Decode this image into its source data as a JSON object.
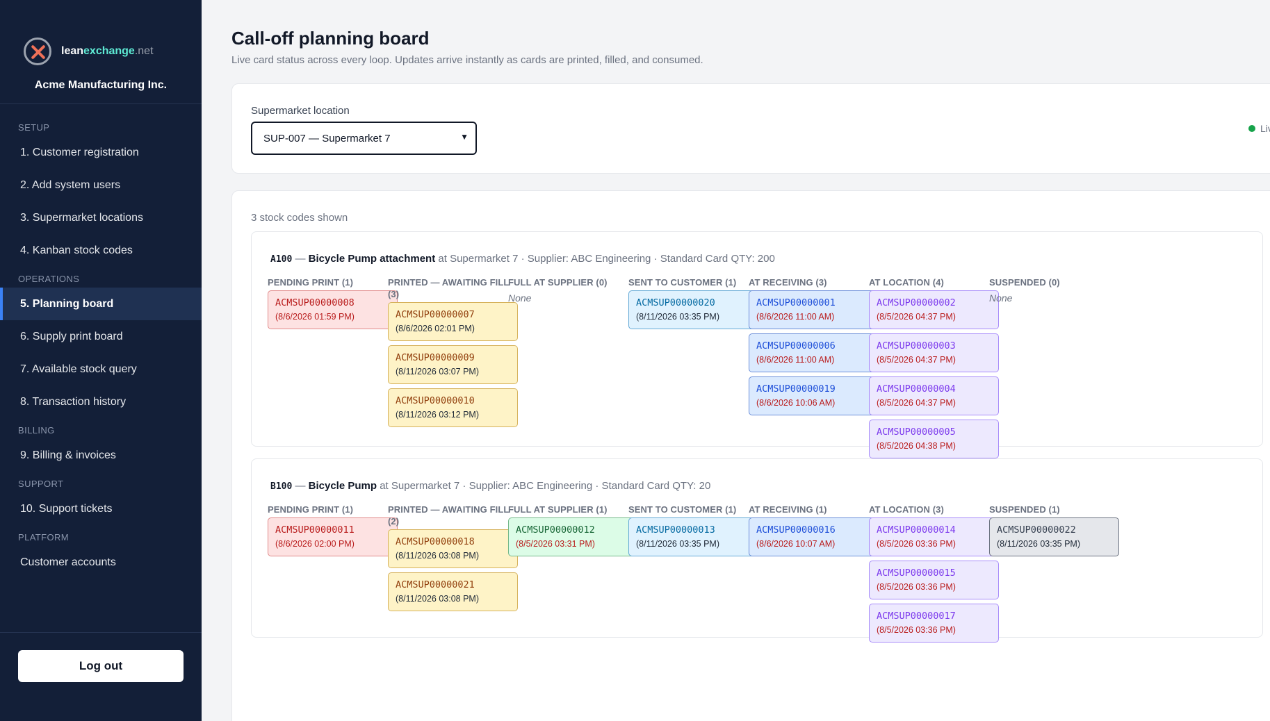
{
  "brand": {
    "logo_lean": "lean",
    "logo_ex": "exchange",
    "logo_net": ".net",
    "company": "Acme Manufacturing Inc."
  },
  "nav": {
    "sections": [
      {
        "label": "SETUP",
        "items": [
          "1. Customer registration",
          "2. Add system users",
          "3. Supermarket locations",
          "4. Kanban stock codes"
        ]
      },
      {
        "label": "OPERATIONS",
        "items": [
          "5. Planning board",
          "6. Supply print board",
          "7. Available stock query",
          "8. Transaction history"
        ]
      },
      {
        "label": "BILLING",
        "items": [
          "9. Billing & invoices"
        ]
      },
      {
        "label": "SUPPORT",
        "items": [
          "10. Support tickets"
        ]
      },
      {
        "label": "PLATFORM",
        "items": [
          "Customer accounts"
        ]
      }
    ],
    "active": "5. Planning board",
    "logout": "Log out"
  },
  "page": {
    "title": "Call-off planning board",
    "subtitle": "Live card status across every loop. Updates arrive instantly as cards are printed, filled, and consumed."
  },
  "location": {
    "label": "Supermarket location",
    "selected": "SUP-007 — Supermarket 7",
    "live": "Live"
  },
  "board": {
    "count_text": "3 stock codes shown",
    "stocks": [
      {
        "code": "A100",
        "name": "Bicycle Pump attachment",
        "meta": "at Supermarket 7 · Supplier: ABC Engineering · Standard Card QTY: 200",
        "columns": [
          {
            "title": "PENDING PRINT (1)",
            "kind": "pending",
            "cards": [
              {
                "id": "ACMSUP00000008",
                "date": "(8/6/2026 01:59 PM)"
              }
            ]
          },
          {
            "title": "PRINTED — AWAITING FILL (3)",
            "kind": "printed",
            "cards": [
              {
                "id": "ACMSUP00000007",
                "date": "(8/6/2026 02:01 PM)"
              },
              {
                "id": "ACMSUP00000009",
                "date": "(8/11/2026 03:07 PM)"
              },
              {
                "id": "ACMSUP00000010",
                "date": "(8/11/2026 03:12 PM)"
              }
            ]
          },
          {
            "title": "FULL AT SUPPLIER (0)",
            "kind": "full",
            "cards": [],
            "empty": "None"
          },
          {
            "title": "SENT TO CUSTOMER (1)",
            "kind": "sent",
            "cards": [
              {
                "id": "ACMSUP00000020",
                "date": "(8/11/2026 03:35 PM)"
              }
            ]
          },
          {
            "title": "AT RECEIVING (3)",
            "kind": "receiving",
            "cards": [
              {
                "id": "ACMSUP00000001",
                "date": "(8/6/2026 11:00 AM)"
              },
              {
                "id": "ACMSUP00000006",
                "date": "(8/6/2026 11:00 AM)"
              },
              {
                "id": "ACMSUP00000019",
                "date": "(8/6/2026 10:06 AM)"
              }
            ]
          },
          {
            "title": "AT LOCATION (4)",
            "kind": "location",
            "cards": [
              {
                "id": "ACMSUP00000002",
                "date": "(8/5/2026 04:37 PM)"
              },
              {
                "id": "ACMSUP00000003",
                "date": "(8/5/2026 04:37 PM)"
              },
              {
                "id": "ACMSUP00000004",
                "date": "(8/5/2026 04:37 PM)"
              },
              {
                "id": "ACMSUP00000005",
                "date": "(8/5/2026 04:38 PM)"
              }
            ]
          },
          {
            "title": "SUSPENDED (0)",
            "kind": "suspended",
            "cards": [],
            "empty": "None"
          }
        ]
      },
      {
        "code": "B100",
        "name": "Bicycle Pump",
        "meta": "at Supermarket 7 · Supplier: ABC Engineering · Standard Card QTY: 20",
        "columns": [
          {
            "title": "PENDING PRINT (1)",
            "kind": "pending",
            "cards": [
              {
                "id": "ACMSUP00000011",
                "date": "(8/6/2026 02:00 PM)"
              }
            ]
          },
          {
            "title": "PRINTED — AWAITING FILL (2)",
            "kind": "printed",
            "cards": [
              {
                "id": "ACMSUP00000018",
                "date": "(8/11/2026 03:08 PM)"
              },
              {
                "id": "ACMSUP00000021",
                "date": "(8/11/2026 03:08 PM)"
              }
            ]
          },
          {
            "title": "FULL AT SUPPLIER (1)",
            "kind": "full",
            "cards": [
              {
                "id": "ACMSUP00000012",
                "date": "(8/5/2026 03:31 PM)"
              }
            ]
          },
          {
            "title": "SENT TO CUSTOMER (1)",
            "kind": "sent",
            "cards": [
              {
                "id": "ACMSUP00000013",
                "date": "(8/11/2026 03:35 PM)"
              }
            ]
          },
          {
            "title": "AT RECEIVING (1)",
            "kind": "receiving",
            "cards": [
              {
                "id": "ACMSUP00000016",
                "date": "(8/6/2026 10:07 AM)"
              }
            ]
          },
          {
            "title": "AT LOCATION (3)",
            "kind": "location",
            "cards": [
              {
                "id": "ACMSUP00000014",
                "date": "(8/5/2026 03:36 PM)"
              },
              {
                "id": "ACMSUP00000015",
                "date": "(8/5/2026 03:36 PM)"
              },
              {
                "id": "ACMSUP00000017",
                "date": "(8/5/2026 03:36 PM)"
              }
            ]
          },
          {
            "title": "SUSPENDED (1)",
            "kind": "suspended",
            "cards": [
              {
                "id": "ACMSUP00000022",
                "date": "(8/11/2026 03:35 PM)"
              }
            ]
          }
        ]
      }
    ]
  }
}
